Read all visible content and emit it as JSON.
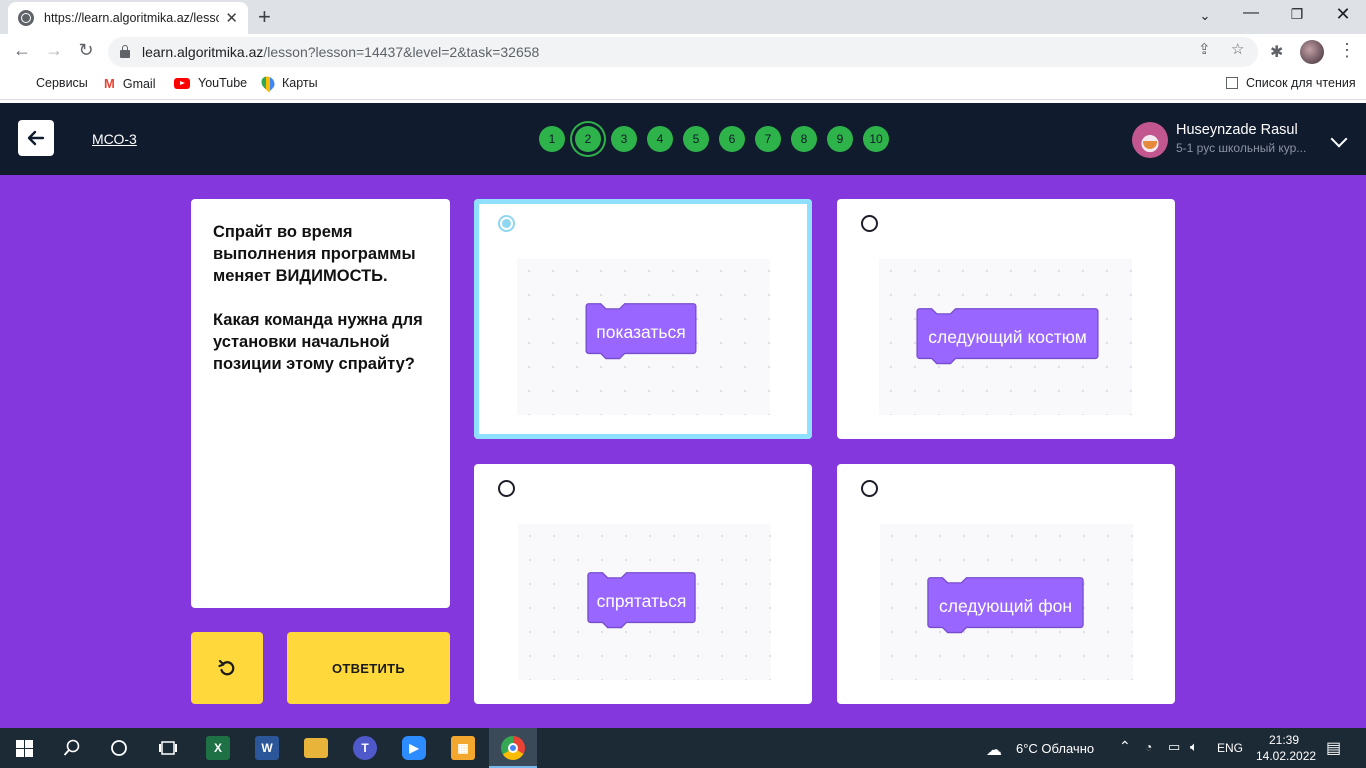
{
  "browser": {
    "tab_title": "https://learn.algoritmika.az/lesso",
    "url_host": "learn.algoritmika.az",
    "url_path": "/lesson?lesson=14437&level=2&task=32658",
    "bookmarks": [
      {
        "label": "Сервисы",
        "icon": "apps-icon"
      },
      {
        "label": "Gmail",
        "icon": "gmail-icon"
      },
      {
        "label": "YouTube",
        "icon": "youtube-icon"
      },
      {
        "label": "Карты",
        "icon": "maps-icon"
      }
    ],
    "reading_list": "Список для чтения"
  },
  "header": {
    "lesson_label": "МСО-3",
    "steps": [
      "1",
      "2",
      "3",
      "4",
      "5",
      "6",
      "7",
      "8",
      "9",
      "10"
    ],
    "current_step": 2,
    "user_name": "Huseynzade Rasul",
    "user_course": "5-1 рус школьный кур...",
    "step_color": "#2db34a",
    "header_bg": "#101b2e"
  },
  "question": {
    "line1": "Спрайт во время выполнения программы меняет ВИДИМОСТЬ.",
    "line2": "Какая команда нужна для установки начальной позиции этому спрайту?"
  },
  "buttons": {
    "answer_label": "ОТВЕТИТЬ",
    "accent": "#ffd93b"
  },
  "options": [
    {
      "block_label": "показаться",
      "selected": true
    },
    {
      "block_label": "следующий костюм",
      "selected": false
    },
    {
      "block_label": "спрятаться",
      "selected": false
    },
    {
      "block_label": "следующий фон",
      "selected": false
    }
  ],
  "colors": {
    "main_bg": "#8337dd",
    "block": "#9966ff",
    "block_stroke": "#774dcb",
    "selected_border": "#8fe0ff"
  },
  "taskbar": {
    "weather": "6°C Облачно",
    "lang": "ENG",
    "time": "21:39",
    "date": "14.02.2022"
  }
}
